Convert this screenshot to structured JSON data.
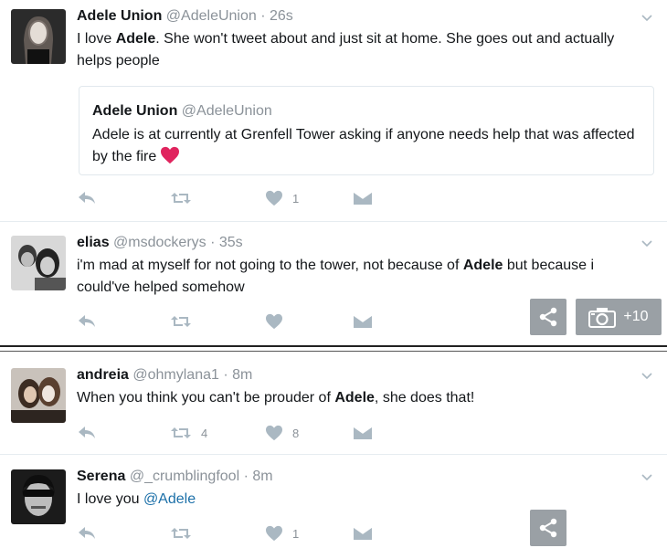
{
  "tweets": [
    {
      "name": "Adele Union",
      "handle": "@AdeleUnion",
      "time": "26s",
      "text_parts": [
        "I love ",
        "Adele",
        ". She won't tweet about and just sit at home. She goes out and actually helps people"
      ],
      "quote": {
        "name": "Adele Union",
        "handle": "@AdeleUnion",
        "text": "Adele is at currently at Grenfell Tower asking if anyone needs help that was affected by the fire"
      },
      "like_count": "1"
    },
    {
      "name": "elias",
      "handle": "@msdockerys",
      "time": "35s",
      "text_parts": [
        "i'm mad at myself for not going to the tower, not because of ",
        "Adele",
        " but because i could've helped somehow"
      ],
      "photo_count": "+10"
    },
    {
      "name": "andreia",
      "handle": "@ohmylana1",
      "time": "8m",
      "text_parts": [
        "When you think you can't be prouder of ",
        "Adele",
        ", she does that!"
      ],
      "retweet_count": "4",
      "like_count": "8"
    },
    {
      "name": "Serena",
      "handle": "@_crumblingfool",
      "time": "8m",
      "text_parts": [
        "I love you "
      ],
      "mention": "@Adele",
      "like_count": "1"
    }
  ],
  "icons": {
    "reply": "reply-icon",
    "retweet": "retweet-icon",
    "like": "heart-icon",
    "dm": "envelope-icon",
    "share": "share-icon",
    "camera": "camera-icon",
    "more": "chevron-down-icon"
  },
  "colors": {
    "text": "#14171a",
    "muted": "#8b9299",
    "mention": "#1b6fa8",
    "heart": "#e0245e",
    "icon": "#aab8c2",
    "overlay_button": "#9aa0a5"
  }
}
